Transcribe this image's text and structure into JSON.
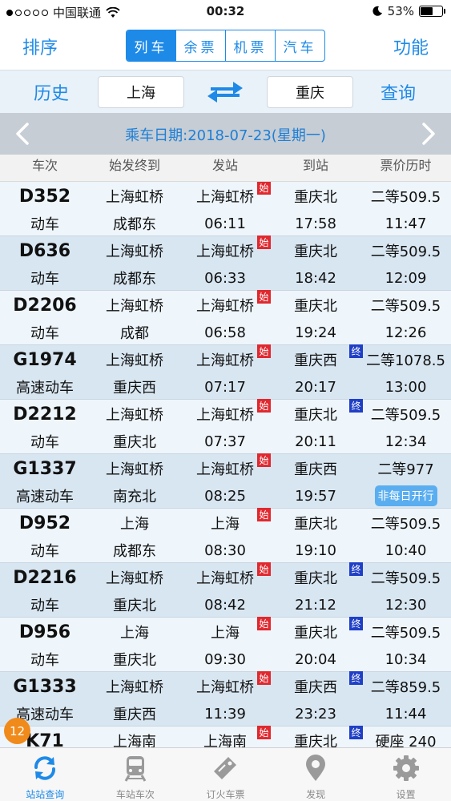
{
  "status_bar": {
    "carrier": "中国联通",
    "time": "00:32",
    "battery": "53%",
    "battery_level": 0.53
  },
  "nav": {
    "sort_label": "排序",
    "function_label": "功能",
    "tabs": [
      {
        "label": "列车",
        "active": true
      },
      {
        "label": "余票",
        "active": false
      },
      {
        "label": "机票",
        "active": false
      },
      {
        "label": "汽车",
        "active": false
      }
    ]
  },
  "route": {
    "history_label": "历史",
    "from": "上海",
    "to": "重庆",
    "query_label": "查询"
  },
  "date_bar": {
    "text": "乘车日期:2018-07-23(星期一)"
  },
  "columns": [
    "车次",
    "始发终到",
    "发站",
    "到站",
    "票价历时"
  ],
  "trains": [
    {
      "no": "D352",
      "type": "动车",
      "origin": "上海虹桥",
      "terminus": "成都东",
      "dep_station": "上海虹桥",
      "dep_start": "始",
      "dep_time": "06:11",
      "arr_station": "重庆北",
      "arr_end": "",
      "arr_time": "17:58",
      "price": "二等509.5",
      "duration": "11:47",
      "note": ""
    },
    {
      "no": "D636",
      "type": "动车",
      "origin": "上海虹桥",
      "terminus": "成都东",
      "dep_station": "上海虹桥",
      "dep_start": "始",
      "dep_time": "06:33",
      "arr_station": "重庆北",
      "arr_end": "",
      "arr_time": "18:42",
      "price": "二等509.5",
      "duration": "12:09",
      "note": ""
    },
    {
      "no": "D2206",
      "type": "动车",
      "origin": "上海虹桥",
      "terminus": "成都",
      "dep_station": "上海虹桥",
      "dep_start": "始",
      "dep_time": "06:58",
      "arr_station": "重庆北",
      "arr_end": "",
      "arr_time": "19:24",
      "price": "二等509.5",
      "duration": "12:26",
      "note": ""
    },
    {
      "no": "G1974",
      "type": "高速动车",
      "origin": "上海虹桥",
      "terminus": "重庆西",
      "dep_station": "上海虹桥",
      "dep_start": "始",
      "dep_time": "07:17",
      "arr_station": "重庆西",
      "arr_end": "终",
      "arr_time": "20:17",
      "price": "二等1078.5",
      "duration": "13:00",
      "note": ""
    },
    {
      "no": "D2212",
      "type": "动车",
      "origin": "上海虹桥",
      "terminus": "重庆北",
      "dep_station": "上海虹桥",
      "dep_start": "始",
      "dep_time": "07:37",
      "arr_station": "重庆北",
      "arr_end": "终",
      "arr_time": "20:11",
      "price": "二等509.5",
      "duration": "12:34",
      "note": ""
    },
    {
      "no": "G1337",
      "type": "高速动车",
      "origin": "上海虹桥",
      "terminus": "南充北",
      "dep_station": "上海虹桥",
      "dep_start": "始",
      "dep_time": "08:25",
      "arr_station": "重庆西",
      "arr_end": "",
      "arr_time": "19:57",
      "price": "二等977",
      "duration": "",
      "note": "非每日开行"
    },
    {
      "no": "D952",
      "type": "动车",
      "origin": "上海",
      "terminus": "成都东",
      "dep_station": "上海",
      "dep_start": "始",
      "dep_time": "08:30",
      "arr_station": "重庆北",
      "arr_end": "",
      "arr_time": "19:10",
      "price": "二等509.5",
      "duration": "10:40",
      "note": ""
    },
    {
      "no": "D2216",
      "type": "动车",
      "origin": "上海虹桥",
      "terminus": "重庆北",
      "dep_station": "上海虹桥",
      "dep_start": "始",
      "dep_time": "08:42",
      "arr_station": "重庆北",
      "arr_end": "终",
      "arr_time": "21:12",
      "price": "二等509.5",
      "duration": "12:30",
      "note": ""
    },
    {
      "no": "D956",
      "type": "动车",
      "origin": "上海",
      "terminus": "重庆北",
      "dep_station": "上海",
      "dep_start": "始",
      "dep_time": "09:30",
      "arr_station": "重庆北",
      "arr_end": "终",
      "arr_time": "20:04",
      "price": "二等509.5",
      "duration": "10:34",
      "note": ""
    },
    {
      "no": "G1333",
      "type": "高速动车",
      "origin": "上海虹桥",
      "terminus": "重庆西",
      "dep_station": "上海虹桥",
      "dep_start": "始",
      "dep_time": "11:39",
      "arr_station": "重庆西",
      "arr_end": "终",
      "arr_time": "23:23",
      "price": "二等859.5",
      "duration": "11:44",
      "note": ""
    },
    {
      "no": "K71",
      "type": "",
      "origin": "上海南",
      "terminus": "",
      "dep_station": "上海南",
      "dep_start": "始",
      "dep_time": "",
      "arr_station": "重庆北",
      "arr_end": "终",
      "arr_time": "",
      "price": "硬座 240",
      "duration": "",
      "note": ""
    }
  ],
  "counter_badge": "12",
  "tab_bar": [
    {
      "label": "站站查询",
      "icon": "refresh-arrows-icon",
      "active": true
    },
    {
      "label": "车站车次",
      "icon": "train-icon",
      "active": false
    },
    {
      "label": "订火车票",
      "icon": "ticket-icon",
      "active": false
    },
    {
      "label": "发现",
      "icon": "location-pin-icon",
      "active": false
    },
    {
      "label": "设置",
      "icon": "gear-icon",
      "active": false
    }
  ],
  "colors": {
    "accent": "#1e8ae8",
    "row_odd": "#eef5fb",
    "row_even": "#d8e6f1",
    "start_badge": "#e0282e",
    "end_badge": "#1f3fc6",
    "counter": "#f08a1a"
  }
}
